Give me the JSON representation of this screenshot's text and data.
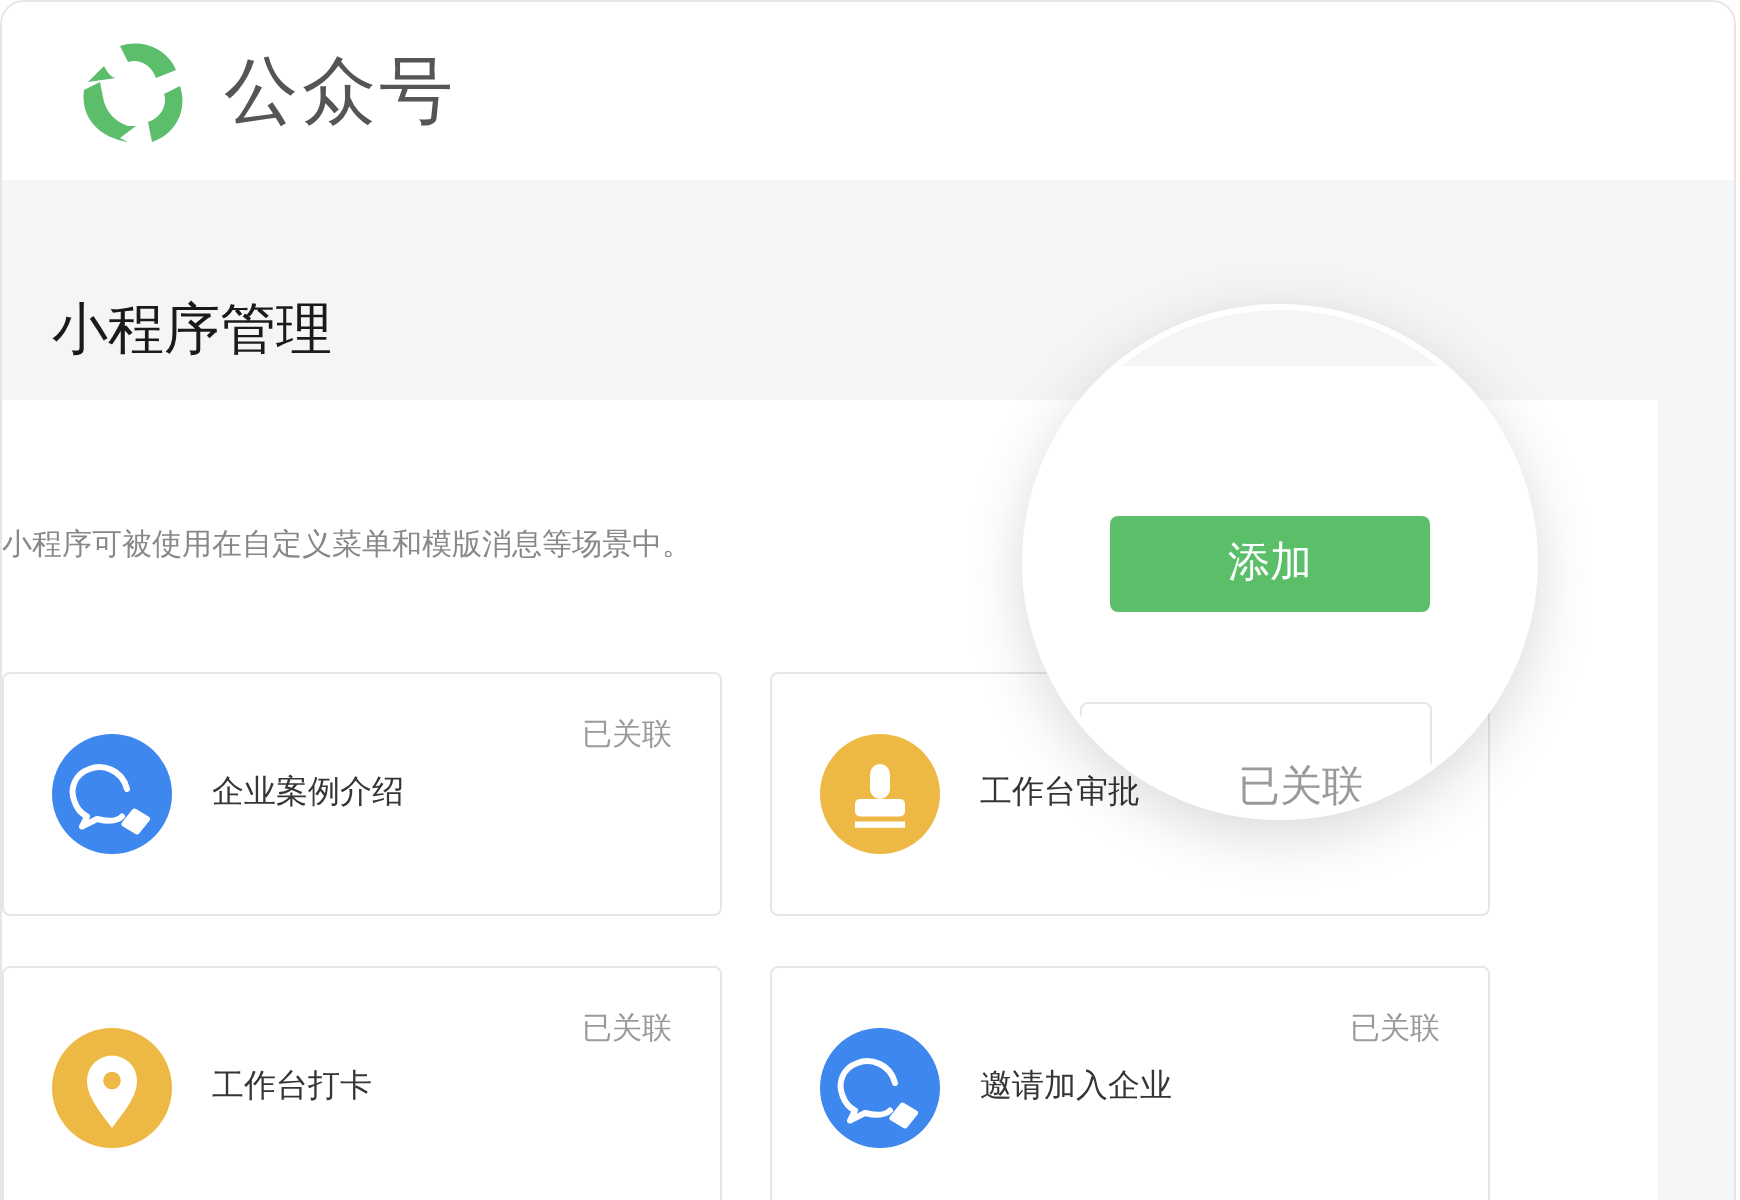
{
  "header": {
    "title": "公众号"
  },
  "page_title": "小程序管理",
  "description": "小程序可被使用在自定义菜单和模版消息等场景中。",
  "cards": [
    {
      "name": "企业案例介绍",
      "status": "已关联",
      "kind": "chat",
      "color": "#3d87ee"
    },
    {
      "name": "工作台审批",
      "kind": "stamp",
      "color": "#edb844"
    },
    {
      "name": "工作台打卡",
      "status": "已关联",
      "kind": "pin",
      "color": "#edb844"
    },
    {
      "name": "邀请加入企业",
      "status": "已关联",
      "kind": "chat",
      "color": "#3d87ee"
    }
  ],
  "magnifier": {
    "button": "添加",
    "status": "已关联"
  }
}
